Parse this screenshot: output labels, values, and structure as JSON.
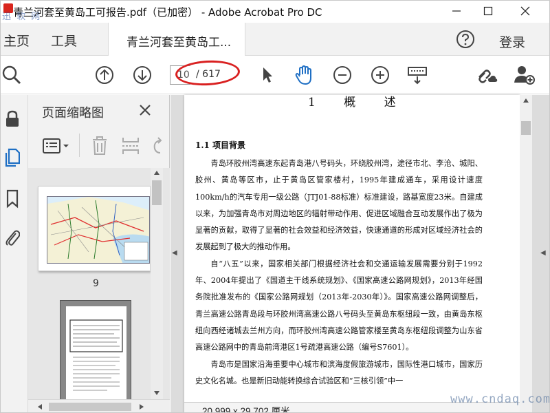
{
  "window": {
    "title": "青兰河套至黄岛工可报告.pdf（已加密） - Adobe Acrobat Pro DC",
    "watermark_top": "迅 软 网",
    "site_watermark": "www.cndaq.com"
  },
  "nav": {
    "home": "主页",
    "tools": "工具",
    "doc_tab": "青兰河套至黄岛工...",
    "login": "登录"
  },
  "toolbar": {
    "page_current": "10",
    "page_total": "/ 617"
  },
  "thumbnails": {
    "title": "页面缩略图",
    "page_label": "9"
  },
  "document": {
    "chapter_title": "1 概 述",
    "section_heading": "1.1 项目背景",
    "paragraphs": [
      "青岛环胶州湾高速东起青岛港八号码头，环绕胶州湾，途径市北、李沧、城阳、胶州、黄岛等区市，止于黄岛区管家楼村，1995年建成通车，采用设计速度100km/h的汽车专用一级公路（JTJ01-88标准）标准建设，路基宽度23米。自建成以来，为加强青岛市对周边地区的辐射带动作用、促进区域融合互动发展作出了极为显著的贡献，取得了显著的社会效益和经济效益，快速通道的形成对区域经济社会的发展起到了极大的推动作用。",
      "自“八五”以来，国家相关部门根据经济社会和交通运输发展需要分别于1992年、2004年提出了《国道主干线系统规划》、《国家高速公路网规划》，2013年经国务院批准发布的《国家公路网规划（2013年-2030年）》。国家高速公路网调整后，青兰高速公路青岛段与环胶州湾高速公路八号码头至黄岛东枢纽段一致，由黄岛东枢纽向西经诸城去兰州方向，而环胶州湾高速公路管家楼至黄岛东枢纽段调整为山东省高速公路网中的青岛前湾港区1号疏港高速公路（编号S7601）。",
      "青岛市是国家沿海重要中心城市和滨海度假旅游城市，国际性港口城市，国家历史文化名城。也是新旧动能转换综合试验区和“三核引领”中一"
    ],
    "page_size": "20.999 x 29.702 厘米"
  }
}
